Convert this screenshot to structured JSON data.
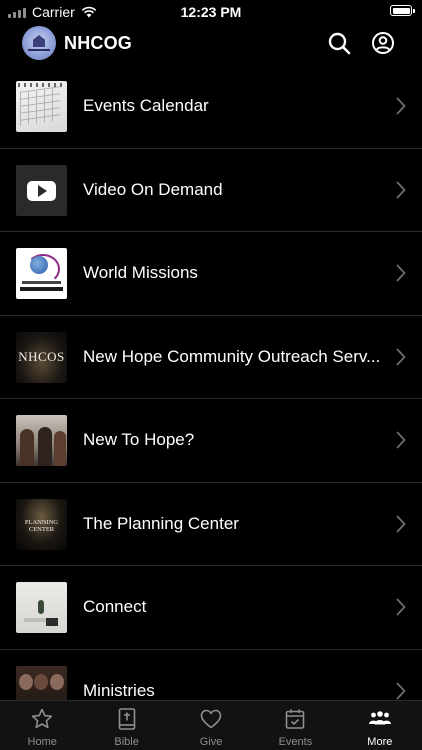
{
  "status_bar": {
    "carrier": "Carrier",
    "time": "12:23 PM"
  },
  "header": {
    "title": "NHCOG",
    "icons": [
      "search-icon",
      "account-icon"
    ]
  },
  "menu_items": [
    {
      "label": "Events Calendar",
      "thumbnail": "calendar-photo"
    },
    {
      "label": "Video On Demand",
      "thumbnail": "youtube-logo"
    },
    {
      "label": "World Missions",
      "thumbnail": "world-missions-logo"
    },
    {
      "label": "New Hope Community Outreach Serv...",
      "thumbnail": "nhcos-logo"
    },
    {
      "label": "New To Hope?",
      "thumbnail": "people-photo"
    },
    {
      "label": "The Planning Center",
      "thumbnail": "planning-center-logo"
    },
    {
      "label": "Connect",
      "thumbnail": "desk-photo"
    },
    {
      "label": "Ministries",
      "thumbnail": "ministries-photo"
    }
  ],
  "thumb_text": {
    "nhcos": "NHCOS",
    "planning_center": "PLANNING CENTER"
  },
  "tabs": [
    {
      "label": "Home",
      "icon": "star-icon",
      "active": false
    },
    {
      "label": "Bible",
      "icon": "bible-icon",
      "active": false
    },
    {
      "label": "Give",
      "icon": "heart-icon",
      "active": false
    },
    {
      "label": "Events",
      "icon": "calendar-check-icon",
      "active": false
    },
    {
      "label": "More",
      "icon": "group-icon",
      "active": true
    }
  ],
  "colors": {
    "background": "#000000",
    "tab_bar": "#121212",
    "separator": "#2b2b2b",
    "inactive_tab": "#8e8e93",
    "active_tab": "#ffffff"
  }
}
